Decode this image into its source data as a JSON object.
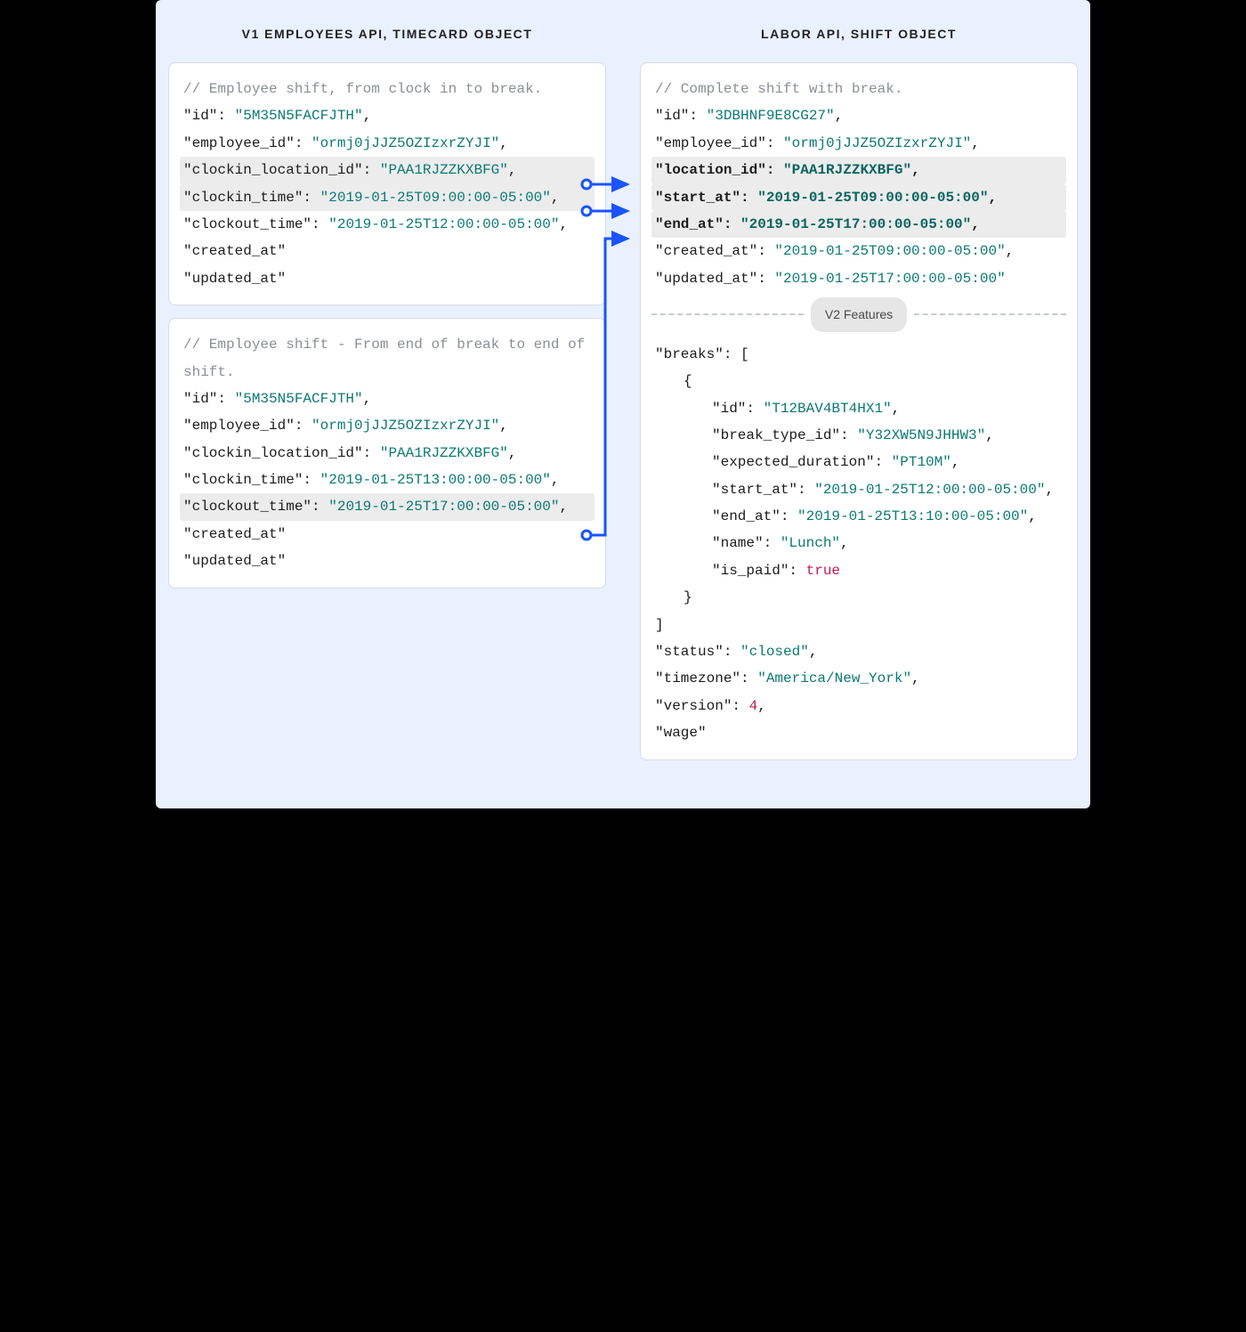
{
  "headers": {
    "left": "V1 EMPLOYEES API, TIMECARD OBJECT",
    "right": "LABOR API, SHIFT OBJECT"
  },
  "left_card1": {
    "comment": "// Employee shift, from clock in to break.",
    "id_k": "\"id\"",
    "id_v": "\"5M35N5FACFJTH\"",
    "emp_k": "\"employee_id\"",
    "emp_v": "\"ormj0jJJZ5OZIzxrZYJI\"",
    "loc_k": "\"clockin_location_id\"",
    "loc_v": "\"PAA1RJZZKXBFG\"",
    "cin_k": "\"clockin_time\"",
    "cin_v": "\"2019-01-25T09:00:00-05:00\"",
    "cout_k": "\"clockout_time\"",
    "cout_v": "\"2019-01-25T12:00:00-05:00\"",
    "cre_k": "\"created_at\"",
    "upd_k": "\"updated_at\""
  },
  "left_card2": {
    "comment": "// Employee shift - From end of break to end of shift.",
    "id_k": "\"id\"",
    "id_v": "\"5M35N5FACFJTH\"",
    "emp_k": "\"employee_id\"",
    "emp_v": "\"ormj0jJJZ5OZIzxrZYJI\"",
    "loc_k": "\"clockin_location_id\"",
    "loc_v": "\"PAA1RJZZKXBFG\"",
    "cin_k": "\"clockin_time\"",
    "cin_v": "\"2019-01-25T13:00:00-05:00\"",
    "cout_k": "\"clockout_time\"",
    "cout_v": "\"2019-01-25T17:00:00-05:00\"",
    "cre_k": "\"created_at\"",
    "upd_k": "\"updated_at\""
  },
  "right_card": {
    "comment": "// Complete shift with break.",
    "id_k": "\"id\"",
    "id_v": "\"3DBHNF9E8CG27\"",
    "emp_k": "\"employee_id\"",
    "emp_v": "\"ormj0jJJZ5OZIzxrZYJI\"",
    "loc_k": "\"location_id\"",
    "loc_v": "\"PAA1RJZZKXBFG\"",
    "sta_k": "\"start_at\"",
    "sta_v": "\"2019-01-25T09:00:00-05:00\"",
    "end_k": "\"end_at\"",
    "end_v": "\"2019-01-25T17:00:00-05:00\"",
    "cre_k": "\"created_at\"",
    "cre_v": "\"2019-01-25T09:00:00-05:00\"",
    "upd_k": "\"updated_at\"",
    "upd_v": "\"2019-01-25T17:00:00-05:00\"",
    "badge": "V2 Features",
    "brk_k": "\"breaks\"",
    "brk_open": "[",
    "brace_open": "{",
    "b_id_k": "\"id\"",
    "b_id_v": "\"T12BAV4BT4HX1\"",
    "b_btid_k": "\"break_type_id\"",
    "b_btid_v": "\"Y32XW5N9JHHW3\"",
    "b_exp_k": "\"expected_duration\"",
    "b_exp_v": "\"PT10M\"",
    "b_sta_k": "\"start_at\"",
    "b_sta_v": "\"2019-01-25T12:00:00-05:00\"",
    "b_end_k": "\"end_at\"",
    "b_end_v": "\"2019-01-25T13:10:00-05:00\"",
    "b_name_k": "\"name\"",
    "b_name_v": "\"Lunch\"",
    "b_paid_k": "\"is_paid\"",
    "b_paid_v": "true",
    "brace_close": "}",
    "brk_close": "]",
    "stat_k": "\"status\"",
    "stat_v": "\"closed\"",
    "tz_k": "\"timezone\"",
    "tz_v": "\"America/New_York\"",
    "ver_k": "\"version\"",
    "ver_v": "4",
    "wage_k": "\"wage\""
  }
}
